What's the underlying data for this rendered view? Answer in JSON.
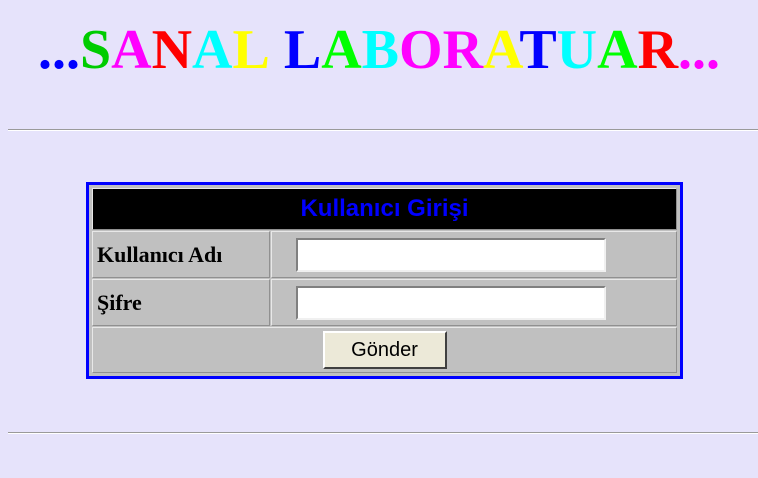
{
  "header": {
    "title_letters": [
      {
        "char": "...",
        "color": "#0000ff"
      },
      {
        "char": "S",
        "color": "#00cc00"
      },
      {
        "char": "A",
        "color": "#ff00ff"
      },
      {
        "char": "N",
        "color": "#ff0000"
      },
      {
        "char": "A",
        "color": "#00ffff"
      },
      {
        "char": "L",
        "color": "#ffff00"
      },
      {
        "char": " ",
        "color": "#000000"
      },
      {
        "char": "L",
        "color": "#0000ff"
      },
      {
        "char": "A",
        "color": "#00ff00"
      },
      {
        "char": "B",
        "color": "#00ffff"
      },
      {
        "char": "O",
        "color": "#ff00ff"
      },
      {
        "char": "R",
        "color": "#ff00ff"
      },
      {
        "char": "A",
        "color": "#ffff00"
      },
      {
        "char": "T",
        "color": "#0000ff"
      },
      {
        "char": "U",
        "color": "#00ffff"
      },
      {
        "char": "A",
        "color": "#00ff00"
      },
      {
        "char": "R",
        "color": "#ff0000"
      },
      {
        "char": "...",
        "color": "#ff00ff"
      }
    ]
  },
  "login": {
    "header": "Kullanıcı Girişi",
    "username_label": "Kullanıcı Adı",
    "username_value": "",
    "password_label": "Şifre",
    "password_value": "",
    "submit_label": "Gönder"
  },
  "colors": {
    "page_background": "#e6e3fb",
    "box_border": "#0000ff",
    "header_background": "#000000",
    "header_text": "#0000ff",
    "table_background": "#c0c0c0"
  }
}
